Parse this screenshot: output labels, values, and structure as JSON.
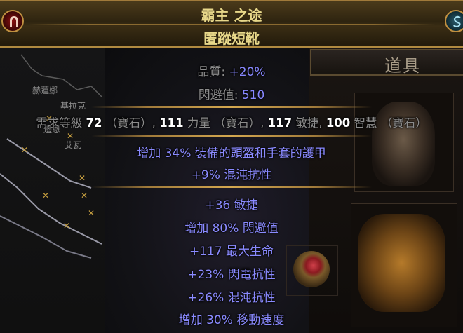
{
  "item": {
    "name": "霸主 之途",
    "base_type": "匿蹤短靴",
    "quality_label": "品質: ",
    "quality_value": "+20%",
    "evasion_label": "閃避值: ",
    "evasion_value": "510",
    "requirements": {
      "prefix": "需求等級 ",
      "level": "72",
      "level_suffix": " （寶石）, ",
      "str": "111",
      "str_label": " 力量 （寶石）, ",
      "dex": "117",
      "dex_label": " 敏捷, ",
      "int": "100",
      "int_label": " 智慧 （寶石）"
    },
    "implicit_mods": [
      "增加 34% 裝備的頭盔和手套的護甲",
      "+9% 混沌抗性"
    ],
    "explicit_mods": [
      "+36 敏捷",
      "增加 80% 閃避值",
      "+117 最大生命",
      "+23% 閃電抗性",
      "+26% 混沌抗性",
      "增加 30% 移動速度"
    ]
  },
  "inventory": {
    "header": "道具"
  },
  "map": {
    "labels": [
      "赫蓮娜",
      "基拉克",
      "邊恩",
      "艾瓦"
    ]
  },
  "colors": {
    "title_text": "#e8d88a",
    "mod_text": "#8888ff",
    "label_text": "#8c8c8c",
    "value_text": "#ffffff",
    "separator": "#c09040"
  }
}
